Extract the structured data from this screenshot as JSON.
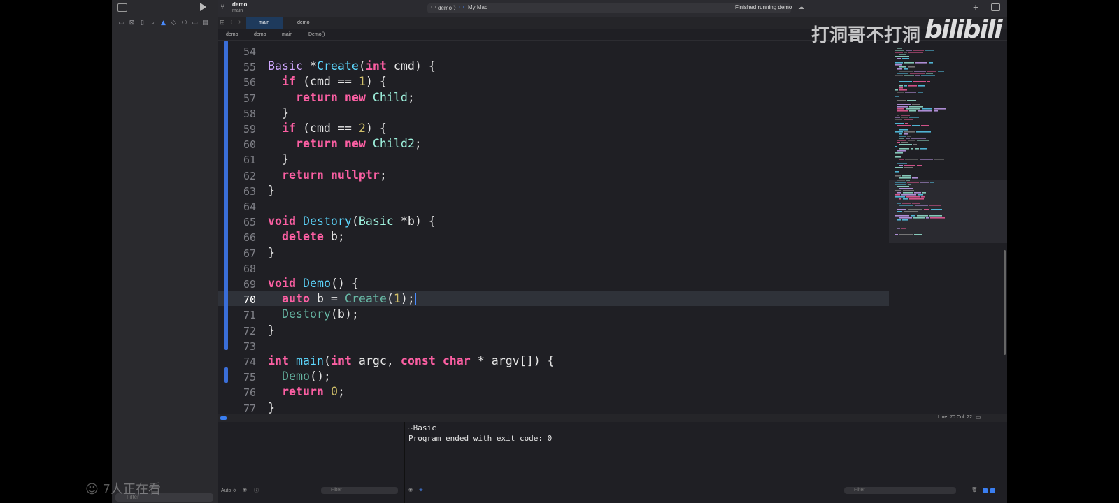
{
  "toolbar": {
    "project": "demo",
    "branch": "main",
    "scheme": "demo 〉",
    "destination": "My Mac",
    "status": "Finished running demo"
  },
  "tabs": [
    {
      "label": "main",
      "selected": true
    },
    {
      "label": "demo",
      "selected": false
    }
  ],
  "jumpbar": [
    "demo",
    "demo",
    "main",
    "Demo()"
  ],
  "editor": {
    "lines": [
      {
        "n": "54",
        "html": ""
      },
      {
        "n": "55",
        "html": "<span class='ty'>Basic</span> *<span class='fd'>Create</span>(<span class='kw'>int</span> cmd) {"
      },
      {
        "n": "56",
        "html": "  <span class='kw'>if</span> (cmd == <span class='num'>1</span>) {"
      },
      {
        "n": "57",
        "html": "    <span class='kw'>return new</span> <span class='cls'>Child</span>;"
      },
      {
        "n": "58",
        "html": "  }"
      },
      {
        "n": "59",
        "html": "  <span class='kw'>if</span> (cmd == <span class='num'>2</span>) {"
      },
      {
        "n": "60",
        "html": "    <span class='kw'>return new</span> <span class='cls'>Child2</span>;"
      },
      {
        "n": "61",
        "html": "  }"
      },
      {
        "n": "62",
        "html": "  <span class='kw'>return nullptr</span>;"
      },
      {
        "n": "63",
        "html": "}"
      },
      {
        "n": "64",
        "html": ""
      },
      {
        "n": "65",
        "html": "<span class='kw'>void</span> <span class='fd'>Destory</span>(<span class='cls'>Basic</span> *b) {"
      },
      {
        "n": "66",
        "html": "  <span class='kw'>delete</span> b;"
      },
      {
        "n": "67",
        "html": "}"
      },
      {
        "n": "68",
        "html": ""
      },
      {
        "n": "69",
        "html": "<span class='kw'>void</span> <span class='fd'>Demo</span>() {"
      },
      {
        "n": "70",
        "html": "  <span class='kw'>auto</span> b = <span class='fn'>Create</span>(<span class='num'>1</span>);"
      },
      {
        "n": "71",
        "html": "  <span class='fn'>Destory</span>(b);"
      },
      {
        "n": "72",
        "html": "}"
      },
      {
        "n": "73",
        "html": ""
      },
      {
        "n": "74",
        "html": "<span class='kw'>int</span> <span class='fd'>main</span>(<span class='kw'>int</span> argc, <span class='kw'>const char</span> * argv[]) {"
      },
      {
        "n": "75",
        "html": "  <span class='fn'>Demo</span>();"
      },
      {
        "n": "76",
        "html": "  <span class='kw'>return</span> <span class='num'>0</span>;"
      },
      {
        "n": "77",
        "html": "}"
      }
    ],
    "current_line": "70"
  },
  "debugbar": {
    "linecol": "Line: 70  Col: 22"
  },
  "console": [
    "~Basic",
    "Program ended with exit code: 0"
  ],
  "bottom": {
    "auto_label": "Auto ≎",
    "filter_placeholder": "Filter"
  },
  "overlay": {
    "watermark": "打洞哥不打洞",
    "logo": "bilibili",
    "viewers": "7人正在看"
  }
}
